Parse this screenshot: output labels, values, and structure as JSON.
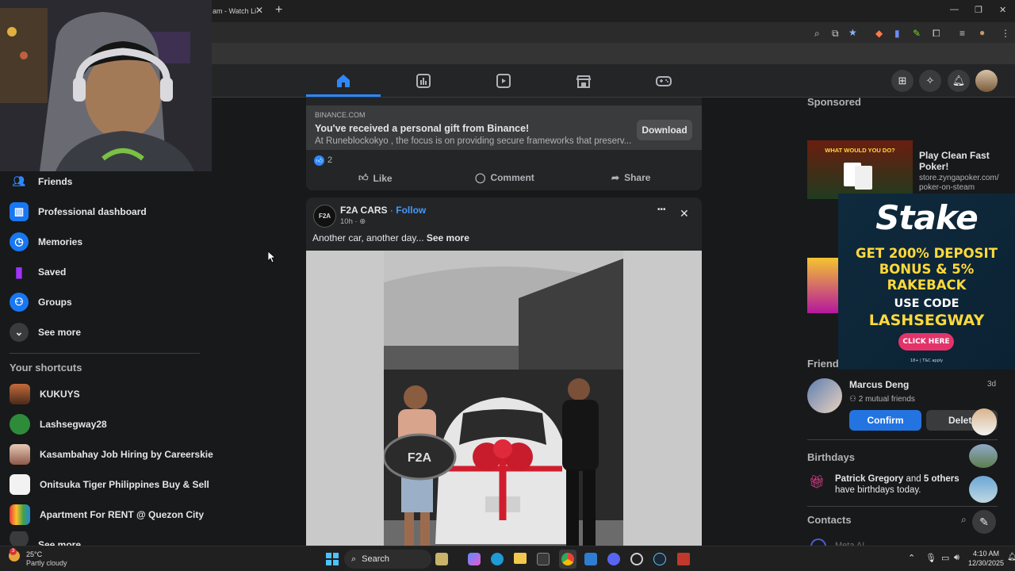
{
  "browser": {
    "tab_title": "am - Watch Li",
    "tab_close": "✕",
    "new_tab": "+",
    "win_min": "—",
    "win_max": "❐",
    "win_close": "✕"
  },
  "sidebar": {
    "items": [
      {
        "label": "Friends",
        "icon": "friends-icon",
        "color": "#1877f2"
      },
      {
        "label": "Professional dashboard",
        "icon": "dashboard-icon",
        "color": "#1877f2"
      },
      {
        "label": "Memories",
        "icon": "memories-icon",
        "color": "#1877f2"
      },
      {
        "label": "Saved",
        "icon": "saved-icon",
        "color": "#a033ff"
      },
      {
        "label": "Groups",
        "icon": "groups-icon",
        "color": "#1877f2"
      },
      {
        "label": "See more",
        "icon": "chevron-down-icon",
        "color": "#3a3b3c"
      }
    ],
    "shortcuts_title": "Your shortcuts",
    "shortcuts": [
      {
        "label": "KUKUYS"
      },
      {
        "label": "Lashsegway28"
      },
      {
        "label": "Kasambahay Job Hiring by Careerskie"
      },
      {
        "label": "Onitsuka Tiger Philippines Buy & Sell"
      },
      {
        "label": "Apartment For RENT @ Quezon City"
      },
      {
        "label": "See more"
      }
    ]
  },
  "ad": {
    "domain": "BINANCE.COM",
    "headline": "You've received a personal gift from Binance!",
    "body": "At Runeblockokyo , the focus is on providing secure frameworks that preserv...",
    "cta": "Download",
    "reactions": "2",
    "like": "Like",
    "comment": "Comment",
    "share": "Share"
  },
  "post": {
    "page_name": "F2A CARS",
    "separator": "·",
    "follow": "Follow",
    "time": "10h ·",
    "text": "Another car, another day...",
    "see_more": "See more",
    "avatar_text": "F2A",
    "more": "•••",
    "close": "✕",
    "logo_text": "F2A"
  },
  "right": {
    "sponsored_title": "Sponsored",
    "sponsor1_title": "Play Clean Fast Poker!",
    "sponsor1_url": "store.zyngapoker.com/ poker-on-steam",
    "sponsor1_img_text": "WHAT WOULD YOU DO?",
    "friend_requests_title": "Friend",
    "friend_name": "Marcus Deng",
    "friend_time": "3d",
    "mutual": "2 mutual friends",
    "confirm": "Confirm",
    "delete": "Delet",
    "birthdays_title": "Birthdays",
    "birthday_name": "Patrick Gregory",
    "birthday_and": " and ",
    "birthday_others": "5 others",
    "birthday_rest": " have birthdays today.",
    "contacts_title": "Contacts",
    "contacts_partial": "Meta AI"
  },
  "stake": {
    "logo": "Stake",
    "line1": "GET 200% DEPOSIT",
    "line2": "BONUS & 5%",
    "line3": "RAKEBACK",
    "line4": "USE CODE",
    "code": "LASHSEGWAY",
    "cta": "CLICK HERE",
    "fine": "18+ | T&C apply",
    "bg_color": "#0f2a3d",
    "text_color": "#ffd93b",
    "cta_color": "#e4336a"
  },
  "taskbar": {
    "temp": "25°C",
    "weather": "Partly cloudy",
    "search": "Search",
    "time": "4:10 AM",
    "date": "12/30/2025",
    "notif_badge": "3"
  }
}
